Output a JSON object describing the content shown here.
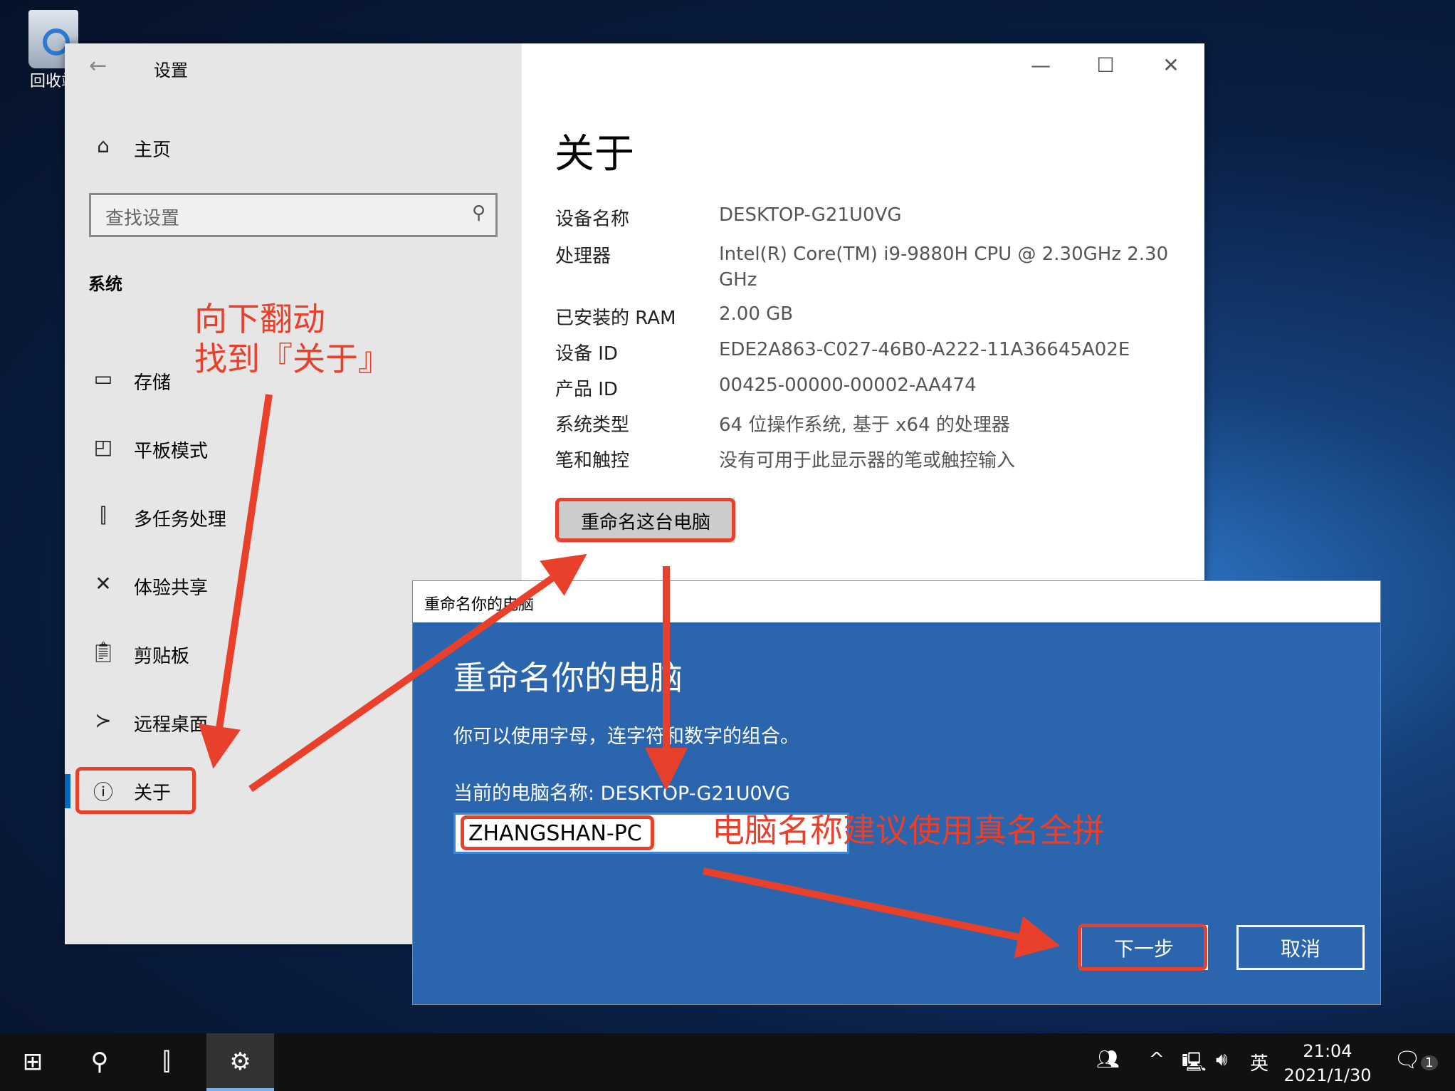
{
  "desktop": {
    "recycle_bin_label": "回收站"
  },
  "settings": {
    "title": "设置",
    "home": "主页",
    "search_placeholder": "查找设置",
    "section": "系统",
    "nav": [
      {
        "label": "存储",
        "icon": "storage-icon"
      },
      {
        "label": "平板模式",
        "icon": "tablet-icon"
      },
      {
        "label": "多任务处理",
        "icon": "multitask-icon"
      },
      {
        "label": "体验共享",
        "icon": "share-icon"
      },
      {
        "label": "剪贴板",
        "icon": "clipboard-icon"
      },
      {
        "label": "远程桌面",
        "icon": "remote-desktop-icon"
      },
      {
        "label": "关于",
        "icon": "info-icon",
        "selected": true
      }
    ],
    "page_title": "关于",
    "specs": [
      {
        "label": "设备名称",
        "value": "DESKTOP-G21U0VG"
      },
      {
        "label": "处理器",
        "value": "Intel(R) Core(TM) i9-9880H CPU @ 2.30GHz   2.30 GHz"
      },
      {
        "label": "已安装的 RAM",
        "value": "2.00 GB"
      },
      {
        "label": "设备 ID",
        "value": "EDE2A863-C027-46B0-A222-11A36645A02E"
      },
      {
        "label": "产品 ID",
        "value": "00425-00000-00002-AA474"
      },
      {
        "label": "系统类型",
        "value": "64 位操作系统, 基于 x64 的处理器"
      },
      {
        "label": "笔和触控",
        "value": "没有可用于此显示器的笔或触控输入"
      }
    ],
    "rename_button": "重命名这台电脑"
  },
  "dialog": {
    "title": "重命名你的电脑",
    "heading": "重命名你的电脑",
    "description": "你可以使用字母，连字符和数字的组合。",
    "current_name": "当前的电脑名称: DESKTOP-G21U0VG",
    "input_value": "ZHANGSHAN-PC",
    "next_button": "下一步",
    "cancel_button": "取消"
  },
  "annotations": {
    "scroll_hint_1": "向下翻动",
    "scroll_hint_2": "找到『关于』",
    "name_hint": "电脑名称建议使用真名全拼",
    "color": "#e8402a"
  },
  "taskbar": {
    "time": "21:04",
    "date": "2021/1/30",
    "ime": "英",
    "notification_count": "1"
  }
}
